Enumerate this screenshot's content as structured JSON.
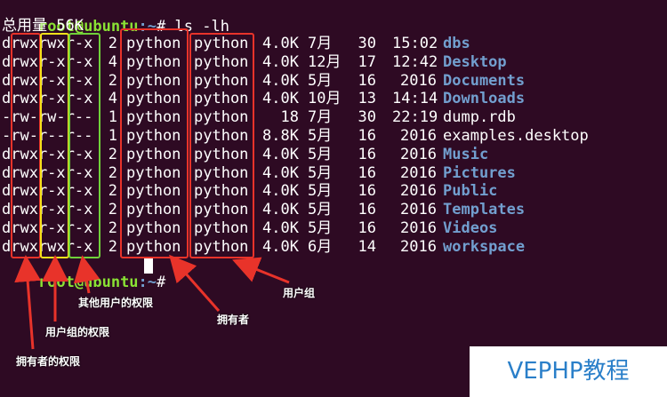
{
  "prompt_top": {
    "user_host": "root@ubuntu",
    "path": ":~",
    "symbol": "# ",
    "command": "ls -lh"
  },
  "total_line": "总用量 56K",
  "rows": [
    {
      "perm": "drwxrwxr-x",
      "links": "2",
      "owner": "python",
      "group": "python",
      "size": "4.0K",
      "month": "7月",
      "day": "30",
      "time": "15:02",
      "name": "dbs",
      "is_dir": true
    },
    {
      "perm": "drwxr-xr-x",
      "links": "4",
      "owner": "python",
      "group": "python",
      "size": "4.0K",
      "month": "12月",
      "day": "17",
      "time": "12:42",
      "name": "Desktop",
      "is_dir": true
    },
    {
      "perm": "drwxr-xr-x",
      "links": "2",
      "owner": "python",
      "group": "python",
      "size": "4.0K",
      "month": "5月",
      "day": "16",
      "time": "2016",
      "name": "Documents",
      "is_dir": true
    },
    {
      "perm": "drwxr-xr-x",
      "links": "4",
      "owner": "python",
      "group": "python",
      "size": "4.0K",
      "month": "10月",
      "day": "13",
      "time": "14:14",
      "name": "Downloads",
      "is_dir": true
    },
    {
      "perm": "-rw-rw-r--",
      "links": "1",
      "owner": "python",
      "group": "python",
      "size": "18",
      "month": "7月",
      "day": "30",
      "time": "22:19",
      "name": "dump.rdb",
      "is_dir": false
    },
    {
      "perm": "-rw-r--r--",
      "links": "1",
      "owner": "python",
      "group": "python",
      "size": "8.8K",
      "month": "5月",
      "day": "16",
      "time": "2016",
      "name": "examples.desktop",
      "is_dir": false
    },
    {
      "perm": "drwxr-xr-x",
      "links": "2",
      "owner": "python",
      "group": "python",
      "size": "4.0K",
      "month": "5月",
      "day": "16",
      "time": "2016",
      "name": "Music",
      "is_dir": true
    },
    {
      "perm": "drwxr-xr-x",
      "links": "2",
      "owner": "python",
      "group": "python",
      "size": "4.0K",
      "month": "5月",
      "day": "16",
      "time": "2016",
      "name": "Pictures",
      "is_dir": true
    },
    {
      "perm": "drwxr-xr-x",
      "links": "2",
      "owner": "python",
      "group": "python",
      "size": "4.0K",
      "month": "5月",
      "day": "16",
      "time": "2016",
      "name": "Public",
      "is_dir": true
    },
    {
      "perm": "drwxr-xr-x",
      "links": "2",
      "owner": "python",
      "group": "python",
      "size": "4.0K",
      "month": "5月",
      "day": "16",
      "time": "2016",
      "name": "Templates",
      "is_dir": true
    },
    {
      "perm": "drwxr-xr-x",
      "links": "2",
      "owner": "python",
      "group": "python",
      "size": "4.0K",
      "month": "5月",
      "day": "16",
      "time": "2016",
      "name": "Videos",
      "is_dir": true
    },
    {
      "perm": "drwxrwxr-x",
      "links": "2",
      "owner": "python",
      "group": "python",
      "size": "4.0K",
      "month": "6月",
      "day": "14",
      "time": "2016",
      "name": "workspace",
      "is_dir": true
    }
  ],
  "prompt_bottom": {
    "user_host": "root@ubuntu",
    "path": ":~",
    "symbol": "# "
  },
  "annotations": {
    "owner_perm": "拥有者的权限",
    "group_perm": "用户组的权限",
    "other_perm": "其他用户的权限",
    "owner": "拥有者",
    "group": "用户组"
  },
  "watermark": "VEPHP教程",
  "colors": {
    "background": "#2e0a23",
    "prompt": "#8ae234",
    "directory": "#729fcf",
    "annotation_box_red": "#e8332a",
    "annotation_box_yellow": "#f4e21a",
    "annotation_box_green": "#70d13a"
  }
}
